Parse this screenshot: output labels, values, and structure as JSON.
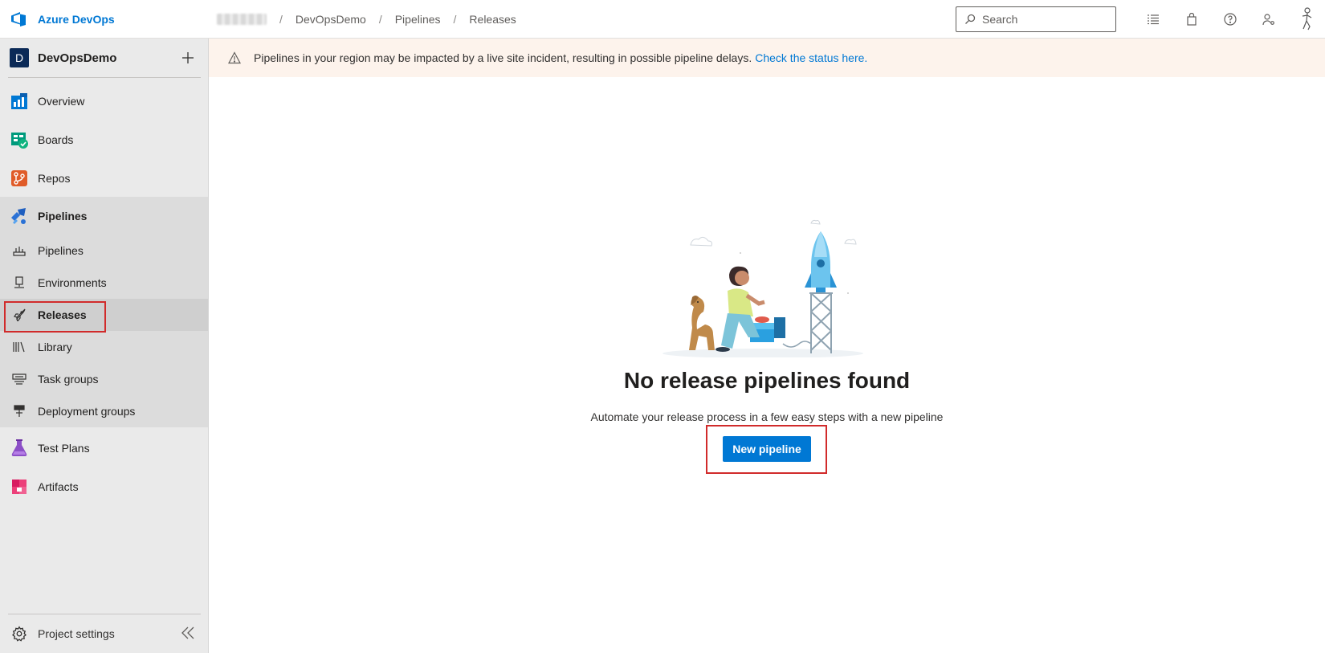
{
  "app": {
    "name": "Azure DevOps"
  },
  "breadcrumb": {
    "items": [
      "DevOpsDemo",
      "Pipelines",
      "Releases"
    ],
    "separator": "/"
  },
  "search": {
    "placeholder": "Search"
  },
  "top_icons": [
    "task-list-icon",
    "shopping-bag-icon",
    "help-icon",
    "user-settings-icon",
    "avatar-icon"
  ],
  "project": {
    "badge": "D",
    "name": "DevOpsDemo"
  },
  "sidebar": {
    "items": [
      {
        "label": "Overview",
        "icon": "overview-icon"
      },
      {
        "label": "Boards",
        "icon": "boards-icon"
      },
      {
        "label": "Repos",
        "icon": "repos-icon"
      },
      {
        "label": "Pipelines",
        "icon": "pipelines-icon"
      },
      {
        "label": "Test Plans",
        "icon": "test-plans-icon"
      },
      {
        "label": "Artifacts",
        "icon": "artifacts-icon"
      }
    ],
    "pipelines_sub": [
      {
        "label": "Pipelines",
        "icon": "pipeline-icon"
      },
      {
        "label": "Environments",
        "icon": "environments-icon"
      },
      {
        "label": "Releases",
        "icon": "rocket-icon",
        "selected": true
      },
      {
        "label": "Library",
        "icon": "library-icon"
      },
      {
        "label": "Task groups",
        "icon": "task-groups-icon"
      },
      {
        "label": "Deployment groups",
        "icon": "deployment-groups-icon"
      }
    ],
    "settings_label": "Project settings"
  },
  "banner": {
    "text": "Pipelines in your region may be impacted by a live site incident, resulting in possible pipeline delays.",
    "link_text": "Check the status here."
  },
  "empty_state": {
    "title": "No release pipelines found",
    "subtitle": "Automate your release process in a few easy steps with a new pipeline",
    "button_label": "New pipeline"
  },
  "colors": {
    "accent": "#0078d4",
    "highlight": "#d12b2b",
    "banner_bg": "#fdf3ec"
  }
}
